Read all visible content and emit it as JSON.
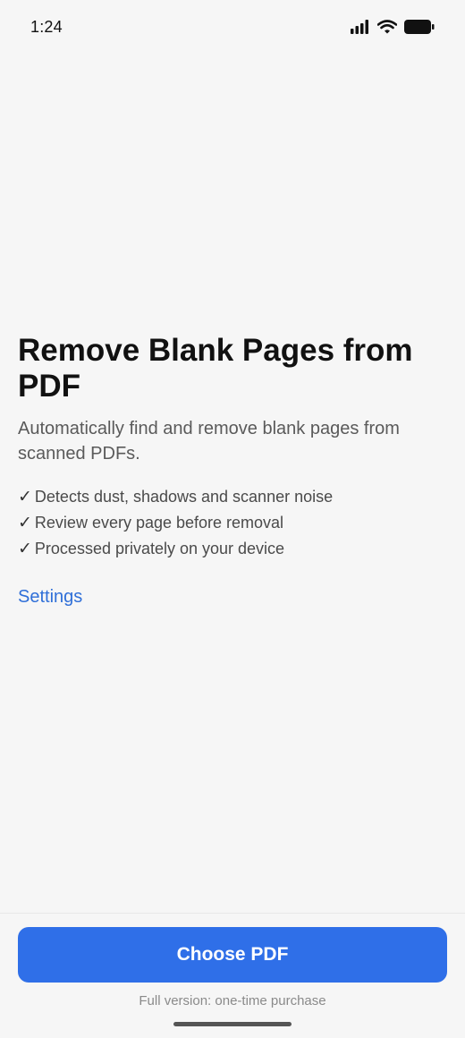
{
  "status_bar": {
    "time": "1:24",
    "icons": [
      "signal-icon",
      "wifi-icon",
      "battery-icon"
    ]
  },
  "main": {
    "title": "Remove Blank Pages from PDF",
    "subtitle": "Automatically find and remove blank pages from scanned PDFs.",
    "features": [
      {
        "check": "✓",
        "text": "Detects dust, shadows and scanner noise"
      },
      {
        "check": "✓",
        "text": "Review every page before removal"
      },
      {
        "check": "✓",
        "text": "Processed privately on your device"
      }
    ],
    "settings_label": "Settings"
  },
  "footer": {
    "button_label": "Choose PDF",
    "note": "Full version: one-time purchase"
  },
  "colors": {
    "background": "#f6f6f6",
    "accent": "#2f6fe8",
    "link": "#2f6fd8"
  }
}
